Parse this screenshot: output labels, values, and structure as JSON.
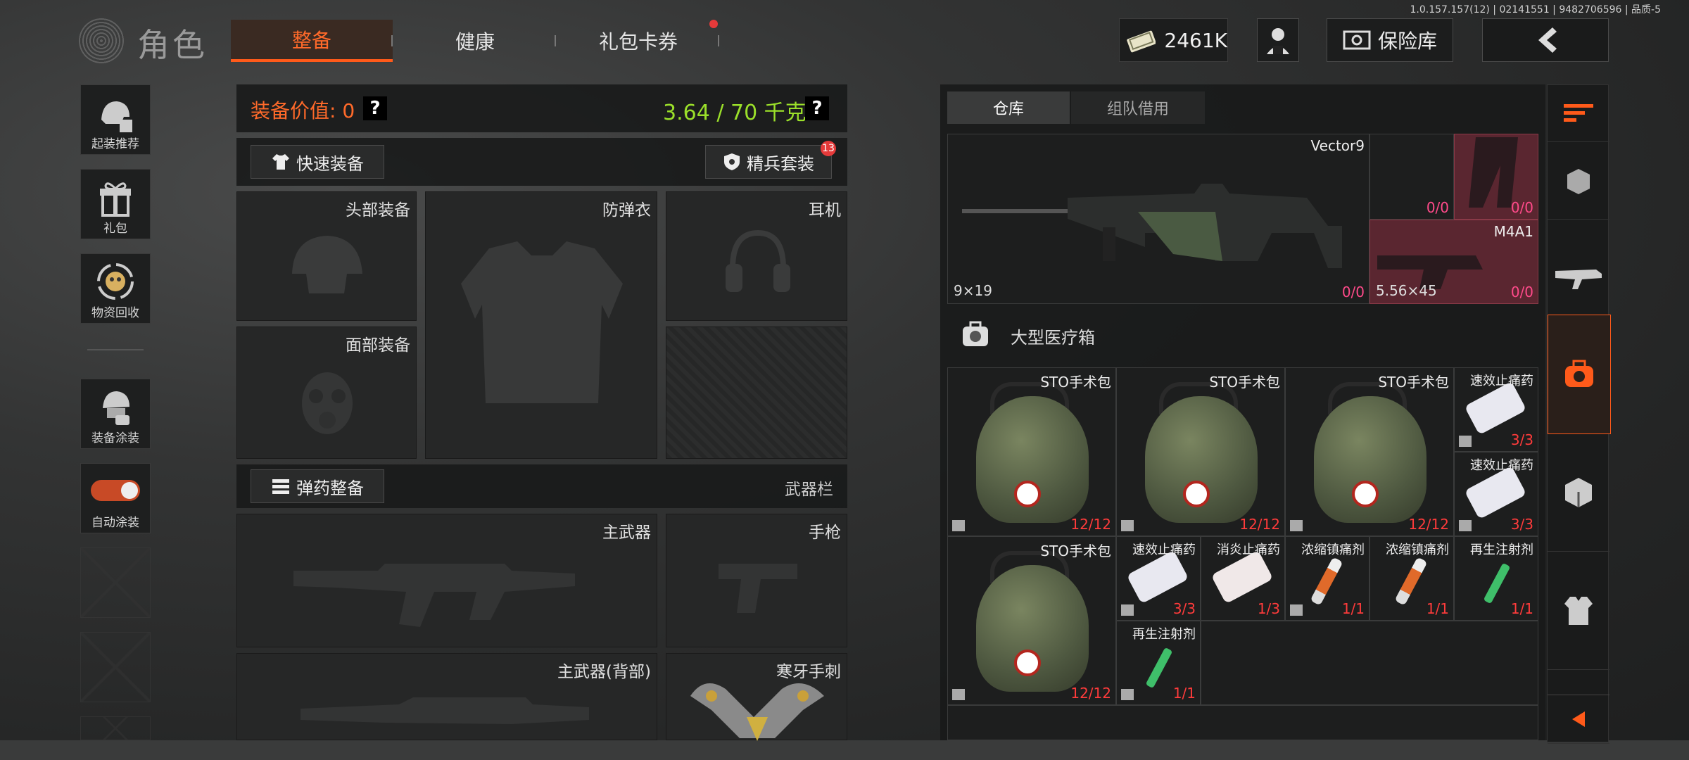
{
  "header": {
    "version": "1.0.157.157(12) | 02141551 | 9482706596 | 品质-5",
    "title": "角色",
    "tabs": [
      {
        "label": "整备",
        "active": true
      },
      {
        "label": "健康",
        "active": false
      },
      {
        "label": "礼包卡券",
        "active": false,
        "dot": true
      }
    ],
    "currency": "2461K",
    "vault_label": "保险库"
  },
  "sidebar": {
    "items": [
      {
        "label": "起装推荐",
        "icon": "helmet-recommend-icon"
      },
      {
        "label": "礼包",
        "icon": "gift-icon"
      },
      {
        "label": "物资回收",
        "icon": "recycle-icon"
      },
      {
        "label": "装备涂装",
        "icon": "paint-icon"
      },
      {
        "label": "自动涂装",
        "icon": "toggle-icon",
        "toggle_on": true
      }
    ]
  },
  "loadout": {
    "value_label": "装备价值: 0",
    "weight": "3.64 / 70 千克",
    "help": "?",
    "quick_equip": "快速装备",
    "elite_set": "精兵套装",
    "elite_badge": "13",
    "slots": {
      "head": "头部装备",
      "armor": "防弹衣",
      "ear": "耳机",
      "face": "面部装备"
    },
    "ammo_equip": "弹药整备",
    "weapon_bar": "武器栏",
    "primary": "主武器",
    "pistol": "手枪",
    "primary_back": "主武器(背部)",
    "melee": "寒牙手刺"
  },
  "storage": {
    "tabs": [
      {
        "label": "仓库",
        "active": true
      },
      {
        "label": "组队借用",
        "active": false
      }
    ],
    "weapon": {
      "name": "Vector9",
      "caliber": "9×19",
      "count": "0/0",
      "side_items": [
        {
          "name": "",
          "count": "0/0"
        },
        {
          "name": "",
          "count": "0/0"
        },
        {
          "name": "M4A1",
          "caliber": "5.56×45",
          "count": "0/0"
        }
      ]
    },
    "med_box_label": "大型医疗箱",
    "items": [
      {
        "name": "STO手术包",
        "count": "12/12"
      },
      {
        "name": "STO手术包",
        "count": "12/12"
      },
      {
        "name": "STO手术包",
        "count": "12/12"
      },
      {
        "name": "速效止痛药",
        "count": "3/3"
      },
      {
        "name": "速效止痛药",
        "count": "3/3"
      },
      {
        "name": "STO手术包",
        "count": "12/12"
      },
      {
        "name": "速效止痛药",
        "count": "3/3"
      },
      {
        "name": "消炎止痛药",
        "count": "1/3"
      },
      {
        "name": "浓缩镇痛剂",
        "count": "1/1"
      },
      {
        "name": "浓缩镇痛剂",
        "count": "1/1"
      },
      {
        "name": "再生注射剂",
        "count": "1/1"
      },
      {
        "name": "再生注射剂",
        "count": "1/1"
      }
    ]
  },
  "colors": {
    "accent": "#ff6a2a",
    "weight": "#9be02a",
    "count_red": "#ff3b3b",
    "badge": "#e53a3a"
  }
}
